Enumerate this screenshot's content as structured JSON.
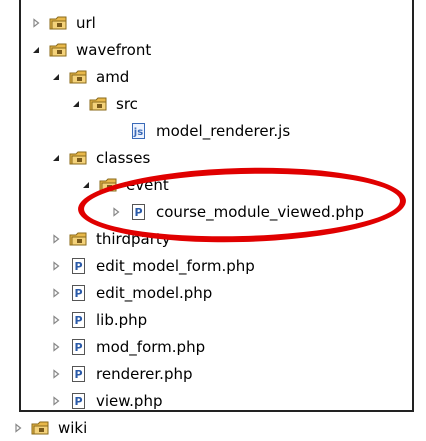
{
  "tree": {
    "items": [
      {
        "label": "url",
        "expander": "collapsed",
        "icon": "package-folder-icon"
      },
      {
        "label": "wavefront",
        "expander": "expanded",
        "icon": "package-folder-icon"
      },
      {
        "label": "amd",
        "expander": "expanded",
        "icon": "package-folder-icon"
      },
      {
        "label": "src",
        "expander": "expanded",
        "icon": "package-folder-icon"
      },
      {
        "label": "model_renderer.js",
        "expander": "none",
        "icon": "js-file-icon"
      },
      {
        "label": "classes",
        "expander": "expanded",
        "icon": "package-folder-icon"
      },
      {
        "label": "event",
        "expander": "expanded",
        "icon": "package-folder-icon"
      },
      {
        "label": "course_module_viewed.php",
        "expander": "collapsed",
        "icon": "php-file-icon"
      },
      {
        "label": "thirdparty",
        "expander": "collapsed",
        "icon": "package-folder-icon"
      },
      {
        "label": "edit_model_form.php",
        "expander": "collapsed",
        "icon": "php-file-icon"
      },
      {
        "label": "edit_model.php",
        "expander": "collapsed",
        "icon": "php-file-icon"
      },
      {
        "label": "lib.php",
        "expander": "collapsed",
        "icon": "php-file-icon"
      },
      {
        "label": "mod_form.php",
        "expander": "collapsed",
        "icon": "php-file-icon"
      },
      {
        "label": "renderer.php",
        "expander": "collapsed",
        "icon": "php-file-icon"
      },
      {
        "label": "view.php",
        "expander": "collapsed",
        "icon": "php-file-icon"
      },
      {
        "label": "wiki",
        "expander": "collapsed",
        "icon": "package-folder-icon"
      }
    ]
  },
  "annotation": {
    "shape": "ellipse",
    "color": "#e00000"
  },
  "colors": {
    "folder": "#e8b84a",
    "folder_edge": "#8a6a1a",
    "php_icon": "#2a5aa8"
  }
}
